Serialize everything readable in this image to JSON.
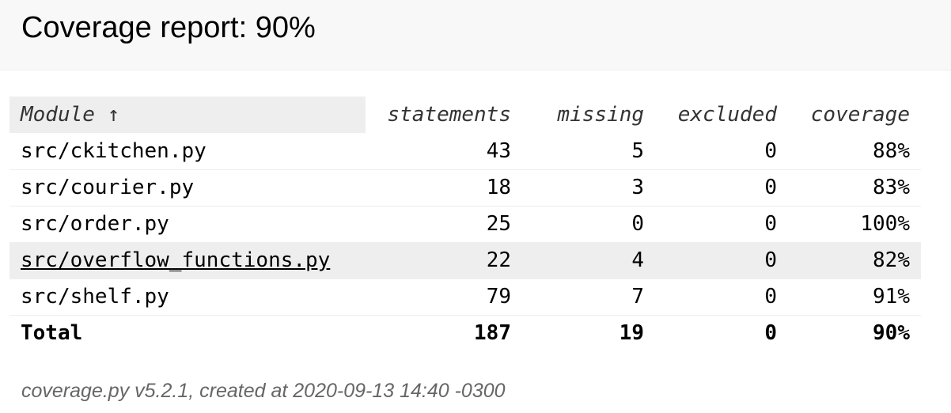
{
  "header": {
    "title": "Coverage report: 90%"
  },
  "table": {
    "columns": {
      "module": "Module ↑",
      "statements": "statements",
      "missing": "missing",
      "excluded": "excluded",
      "coverage": "coverage"
    },
    "rows": [
      {
        "name": "src/ckitchen.py",
        "statements": "43",
        "missing": "5",
        "excluded": "0",
        "coverage": "88%"
      },
      {
        "name": "src/courier.py",
        "statements": "18",
        "missing": "3",
        "excluded": "0",
        "coverage": "83%"
      },
      {
        "name": "src/order.py",
        "statements": "25",
        "missing": "0",
        "excluded": "0",
        "coverage": "100%"
      },
      {
        "name": "src/overflow_functions.py",
        "statements": "22",
        "missing": "4",
        "excluded": "0",
        "coverage": "82%"
      },
      {
        "name": "src/shelf.py",
        "statements": "79",
        "missing": "7",
        "excluded": "0",
        "coverage": "91%"
      }
    ],
    "total": {
      "name": "Total",
      "statements": "187",
      "missing": "19",
      "excluded": "0",
      "coverage": "90%"
    },
    "hovered_row": "src/overflow_functions.py"
  },
  "footer": {
    "text": "coverage.py v5.2.1, created at 2020-09-13 14:40 -0300"
  }
}
